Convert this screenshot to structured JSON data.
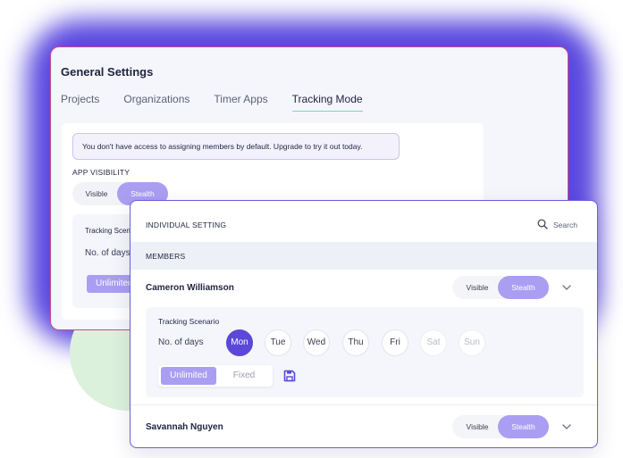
{
  "general_settings": {
    "title": "General Settings",
    "tabs": [
      {
        "label": "Projects",
        "active": false
      },
      {
        "label": "Organizations",
        "active": false
      },
      {
        "label": "Timer Apps",
        "active": false
      },
      {
        "label": "Tracking Mode",
        "active": true
      }
    ],
    "notice": "You don't have access to assigning members by default. Upgrade to try it out today.",
    "app_visibility": {
      "label": "APP VISIBILITY",
      "options": [
        "Visible",
        "Stealth"
      ],
      "selected": "Stealth"
    },
    "tracking_label": "Tracking Scenario",
    "days_label": "No. of days",
    "limit_selected": "Unlimited"
  },
  "individual_setting": {
    "title": "INDIVIDUAL SETTING",
    "search_label": "Search",
    "search_icon": "search-icon",
    "members_header": "MEMBERS",
    "members": [
      {
        "name": "Cameron Williamson",
        "visibility_options": [
          "Visible",
          "Stealth"
        ],
        "visibility_selected": "Stealth",
        "expanded": true,
        "tracking": {
          "label": "Tracking Scenario",
          "days_label": "No. of days",
          "days": [
            {
              "label": "Mon",
              "state": "selected"
            },
            {
              "label": "Tue",
              "state": "normal"
            },
            {
              "label": "Wed",
              "state": "normal"
            },
            {
              "label": "Thu",
              "state": "normal"
            },
            {
              "label": "Fri",
              "state": "normal"
            },
            {
              "label": "Sat",
              "state": "disabled"
            },
            {
              "label": "Sun",
              "state": "disabled"
            }
          ],
          "limit_options": [
            "Unlimited",
            "Fixed"
          ],
          "limit_selected": "Unlimited",
          "save_icon": "save-icon"
        }
      },
      {
        "name": "Savannah Nguyen",
        "visibility_options": [
          "Visible",
          "Stealth"
        ],
        "visibility_selected": "Stealth",
        "expanded": false
      }
    ]
  },
  "colors": {
    "accent": "#5b48d8",
    "accent_light": "#a99ef2",
    "glow": "#5a47df",
    "back_panel_border": "#c94a87",
    "tab_underline": "#7ad3c7"
  }
}
